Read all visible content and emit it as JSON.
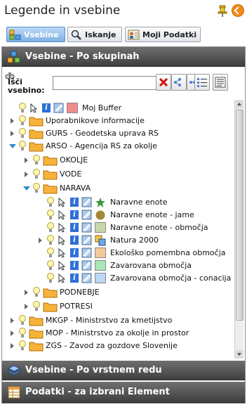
{
  "window": {
    "title": "Legende in vsebine"
  },
  "tabs": [
    {
      "label": "Vsebine",
      "icon": "content-tab-icon"
    },
    {
      "label": "Iskanje",
      "icon": "magnifier-icon"
    },
    {
      "label": "Moji Podatki",
      "icon": "user-card-icon"
    }
  ],
  "sections": {
    "by_group": {
      "label": "Vsebine - Po skupinah",
      "icon": "grouped-layers-icon"
    },
    "by_order": {
      "label": "Vsebine - Po vrstnem redu",
      "icon": "stacked-layers-icon"
    },
    "element_data": {
      "label": "Podatki - za izbrani Element",
      "icon": "table-icon"
    }
  },
  "search": {
    "label": "Išči vsebino:",
    "value": "",
    "placeholder": ""
  },
  "tree": [
    {
      "label": "Moj Buffer",
      "symbol": {
        "type": "swatch",
        "color": "#f08c8c"
      }
    },
    {
      "label": "Uporabnikove informacije"
    },
    {
      "label": "GURS - Geodetska uprava RS"
    },
    {
      "label": "ARSO - Agencija RS za okolje"
    },
    {
      "label": "OKOLJE"
    },
    {
      "label": "VODE"
    },
    {
      "label": "NARAVA"
    },
    {
      "label": "Naravne enote",
      "symbol": {
        "type": "star",
        "color": "#3a9a3a"
      }
    },
    {
      "label": "Naravne enote - jame",
      "symbol": {
        "type": "circle",
        "color": "#a38735"
      }
    },
    {
      "label": "Naravne enote - območja",
      "symbol": {
        "type": "swatch",
        "color": "#c7d8a8"
      }
    },
    {
      "label": "Natura 2000",
      "symbol": {
        "type": "multi",
        "color": "#f2c94c"
      }
    },
    {
      "label": "Ekološko pomembna območja",
      "symbol": {
        "type": "swatch",
        "color": "#f5c89a"
      }
    },
    {
      "label": "Zavarovana območja",
      "symbol": {
        "type": "swatch",
        "color": "#a8e6b8"
      }
    },
    {
      "label": "Zavarovana območja - conacija",
      "symbol": {
        "type": "swatch",
        "color": "#bcd6f5"
      }
    },
    {
      "label": "PODNEBJE"
    },
    {
      "label": "POTRESI"
    },
    {
      "label": "MKGP - Ministrstvo za kmetijstvo"
    },
    {
      "label": "MOP - Ministrstvo za okolje in prostor"
    },
    {
      "label": "ZGS - Zavod za gozdove Slovenije"
    }
  ]
}
